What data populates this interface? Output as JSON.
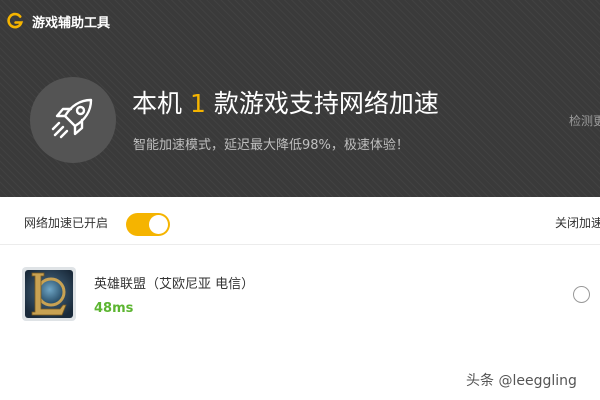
{
  "app": {
    "title": "游戏辅助工具",
    "logo_icon": "g-logo-icon",
    "accent_color": "#f5b400"
  },
  "hero": {
    "icon": "rocket-icon",
    "title_prefix": "本机",
    "count": "1",
    "title_suffix": "款游戏支持网络加速",
    "subtitle": "智能加速模式，延迟最大降低98%，极速体验！",
    "detect_label": "检测更"
  },
  "status": {
    "label": "网络加速已开启",
    "toggle_on": true,
    "close_label": "关闭加速"
  },
  "games": [
    {
      "name": "英雄联盟（艾欧尼亚 电信）",
      "ping": "48ms",
      "icon": "league-of-legends-icon",
      "selected": false
    }
  ],
  "watermark": "头条 @leeggling"
}
